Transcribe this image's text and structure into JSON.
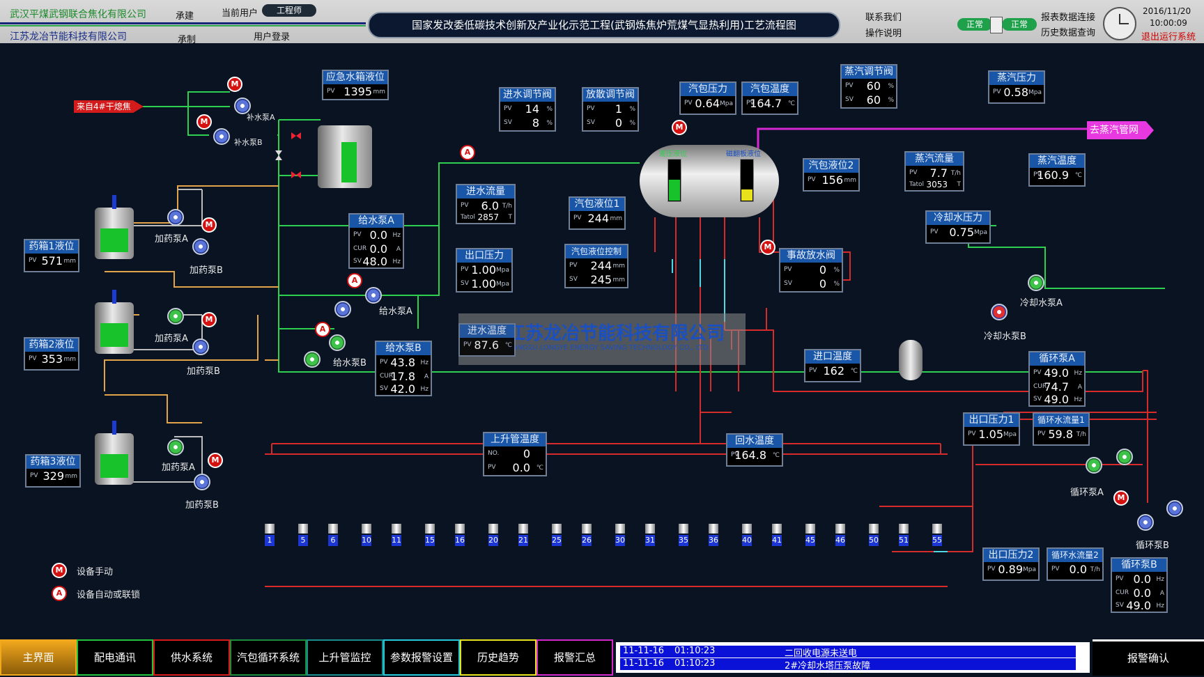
{
  "header": {
    "company_main": "武汉平煤武钢联合焦化有限公司",
    "build_label": "承建",
    "current_user_label": "当前用户",
    "current_user": "工程师",
    "company_sub": "江苏龙冶节能科技有限公司",
    "made_label": "承制",
    "login_label": "用户登录",
    "title": "国家发改委低碳技术创新及产业化示范工程(武钢炼焦炉荒煤气显热利用)工艺流程图",
    "contact": "联系我们",
    "manual": "操作说明",
    "status1": "正常",
    "status2": "正常",
    "report_link": "报表数据连接",
    "history_query": "历史数据查询",
    "date": "2016/11/20",
    "time": "10:00:09",
    "exit": "退出运行系统"
  },
  "source_tag": "来自4#干熄焦",
  "dest_tag": "去蒸汽管网",
  "watermark": {
    "cn": "江苏龙冶节能科技有限公司",
    "en": "JIANGSU LONGYE ENERGY SAVING TECHNOLOGY CO., LTD."
  },
  "labels": {
    "refill_a": "补水泵A",
    "refill_b": "补水泵B",
    "dose_a1": "加药泵A",
    "dose_b1": "加药泵B",
    "dose_a2": "加药泵A",
    "dose_b2": "加药泵B",
    "dose_a3": "加药泵A",
    "dose_b3": "加药泵B",
    "feed_a": "给水泵A",
    "feed_b": "给水泵B",
    "cool_a": "冷却水泵A",
    "cool_b": "冷却水泵B",
    "circ_a": "循环泵A",
    "circ_b": "循环泵B",
    "drum_left": "差压液位",
    "drum_right": "磁翻板液位"
  },
  "panels": {
    "tank1": {
      "title": "药箱1液位",
      "pv": "571",
      "unit": "mm"
    },
    "tank2": {
      "title": "药箱2液位",
      "pv": "353",
      "unit": "mm"
    },
    "tank3": {
      "title": "药箱3液位",
      "pv": "329",
      "unit": "mm"
    },
    "emerg": {
      "title": "应急水箱液位",
      "pv": "1395",
      "unit": "mm"
    },
    "inlet_valve": {
      "title": "进水调节阀",
      "pv": "14",
      "sv": "8",
      "unit": "%"
    },
    "vent_valve": {
      "title": "放散调节阀",
      "pv": "1",
      "sv": "0",
      "unit": "%"
    },
    "drum_press": {
      "title": "汽包压力",
      "pv": "0.64",
      "unit": "Mpa"
    },
    "drum_temp": {
      "title": "汽包温度",
      "pv": "164.7",
      "unit": "℃"
    },
    "steam_valve": {
      "title": "蒸汽调节阀",
      "pv": "60",
      "sv": "60",
      "unit": "%"
    },
    "steam_press": {
      "title": "蒸汽压力",
      "pv": "0.58",
      "unit": "Mpa"
    },
    "inlet_flow": {
      "title": "进水流量",
      "pv": "6.0",
      "unit": "T/h",
      "total_label": "Tatol",
      "total": "2857",
      "total_unit": "T"
    },
    "drum_level1": {
      "title": "汽包液位1",
      "pv": "244",
      "unit": "mm"
    },
    "drum_level2": {
      "title": "汽包液位2",
      "pv": "156",
      "unit": "mm"
    },
    "steam_flow": {
      "title": "蒸汽流量",
      "pv": "7.7",
      "unit": "T/h",
      "total_label": "Tatol",
      "total": "3053",
      "total_unit": "T"
    },
    "steam_temp": {
      "title": "蒸汽温度",
      "pv": "160.9",
      "unit": "℃"
    },
    "feed_pump_a": {
      "title": "给水泵A",
      "pv": "0.0",
      "cur": "0.0",
      "sv": "48.0"
    },
    "outlet_press": {
      "title": "出口压力",
      "pv": "1.00",
      "sv": "1.00",
      "unit": "Mpa"
    },
    "level_ctrl": {
      "title": "汽包液位控制",
      "pv": "244",
      "sv": "245",
      "unit": "mm"
    },
    "cool_press": {
      "title": "冷却水压力",
      "pv": "0.75",
      "unit": "Mpa"
    },
    "drain_valve": {
      "title": "事故放水阀",
      "pv": "0",
      "sv": "0",
      "unit": "%"
    },
    "inlet_temp_feed": {
      "title": "进水温度",
      "pv": "87.6",
      "unit": "℃"
    },
    "feed_pump_b": {
      "title": "给水泵B",
      "pv": "43.8",
      "cur": "17.8",
      "sv": "42.0"
    },
    "inlet_temp": {
      "title": "进口温度",
      "pv": "162",
      "unit": "℃"
    },
    "circ_a": {
      "title": "循环泵A",
      "pv": "49.0",
      "cur": "74.7",
      "sv": "49.0"
    },
    "riser_temp": {
      "title": "上升管温度",
      "no_label": "NO.",
      "no": "0",
      "pv": "0.0",
      "unit": "℃"
    },
    "return_temp": {
      "title": "回水温度",
      "pv": "164.8",
      "unit": "℃"
    },
    "out_press1": {
      "title": "出口压力1",
      "pv": "1.05",
      "unit": "Mpa"
    },
    "circ_flow1": {
      "title": "循环水流量1",
      "pv": "59.8",
      "unit": "T/h"
    },
    "out_press2": {
      "title": "出口压力2",
      "pv": "0.89",
      "unit": "Mpa"
    },
    "circ_flow2": {
      "title": "循环水流量2",
      "pv": "0.0",
      "unit": "T/h"
    },
    "circ_b": {
      "title": "循环泵B",
      "pv": "0.0",
      "cur": "0.0",
      "sv": "49.0"
    }
  },
  "units": {
    "hz": "Hz",
    "a": "A",
    "pv": "PV",
    "sv": "SV",
    "cur": "CUR"
  },
  "tubes": [
    [
      "1",
      "5"
    ],
    [
      "6",
      "10"
    ],
    [
      "11",
      "15"
    ],
    [
      "16",
      "20"
    ],
    [
      "21",
      "25"
    ],
    [
      "26",
      "30"
    ],
    [
      "31",
      "35"
    ],
    [
      "36",
      "40"
    ],
    [
      "41",
      "45"
    ],
    [
      "46",
      "50"
    ],
    [
      "51",
      "55"
    ]
  ],
  "legend": {
    "manual": "设备手动",
    "auto": "设备自动或联锁",
    "m": "M",
    "a": "A"
  },
  "tabs": [
    "主界面",
    "配电通讯",
    "供水系统",
    "汽包循环系统",
    "上升管监控",
    "参数报警设置",
    "历史趋势",
    "报警汇总"
  ],
  "tab_colors": [
    "#f2a81d",
    "#22c43e",
    "#d61a1a",
    "#1c8c3a",
    "#1b8c8c",
    "#25c8d8",
    "#e8e21c",
    "#d427c9"
  ],
  "alarms": [
    {
      "date": "11-11-16",
      "time": "01:10:23",
      "msg": "二回收电源未送电"
    },
    {
      "date": "11-11-16",
      "time": "01:10:23",
      "msg": "2#冷却水塔压泵故障"
    }
  ],
  "confirm": "报警确认"
}
